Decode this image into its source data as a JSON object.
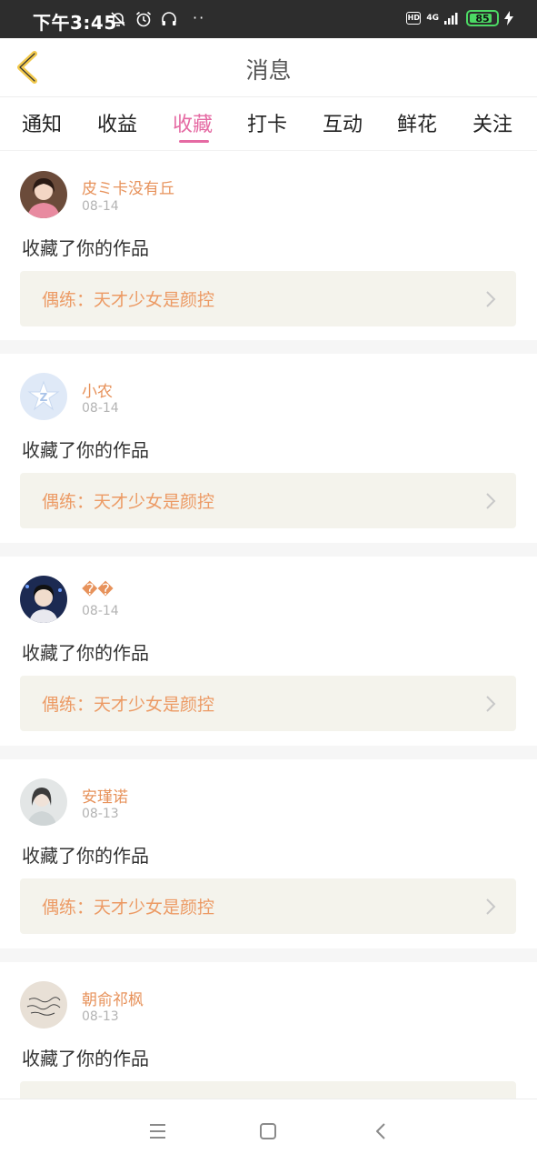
{
  "status_bar": {
    "time": "下午3:45",
    "icons": [
      "mute-bell-icon",
      "alarm-icon",
      "headset-icon"
    ],
    "dots": "··",
    "hd": "HD",
    "network": "4G",
    "battery": "85",
    "battery_level": 0.85
  },
  "header": {
    "title": "消息",
    "back_icon": "chevron-left-icon",
    "accent": "#f2c94c"
  },
  "tabs": [
    {
      "label": "通知"
    },
    {
      "label": "收益"
    },
    {
      "label": "收藏",
      "active": true
    },
    {
      "label": "打卡"
    },
    {
      "label": "互动"
    },
    {
      "label": "鲜花"
    },
    {
      "label": "关注"
    }
  ],
  "messages": [
    {
      "name": "皮ミ卡没有丘",
      "date": "08-14",
      "text": "收藏了你的作品",
      "work": "偶练：天才少女是颜控"
    },
    {
      "name": "小农",
      "date": "08-14",
      "text": "收藏了你的作品",
      "work": "偶练：天才少女是颜控"
    },
    {
      "name": "��",
      "date": "08-14",
      "text": "收藏了你的作品",
      "work": "偶练：天才少女是颜控"
    },
    {
      "name": "安瑾诺",
      "date": "08-13",
      "text": "收藏了你的作品",
      "work": "偶练：天才少女是颜控"
    },
    {
      "name": "朝俞祁枫",
      "date": "08-13",
      "text": "收藏了你的作品",
      "work": ""
    }
  ],
  "colors": {
    "active_tab": "#e56aa3",
    "username": "#e7925b",
    "work_text": "#ec9a64",
    "work_bg": "#f4f3ec"
  },
  "nav_bar": {
    "icons": [
      "menu-icon",
      "home-square-icon",
      "back-triangle-icon"
    ]
  }
}
